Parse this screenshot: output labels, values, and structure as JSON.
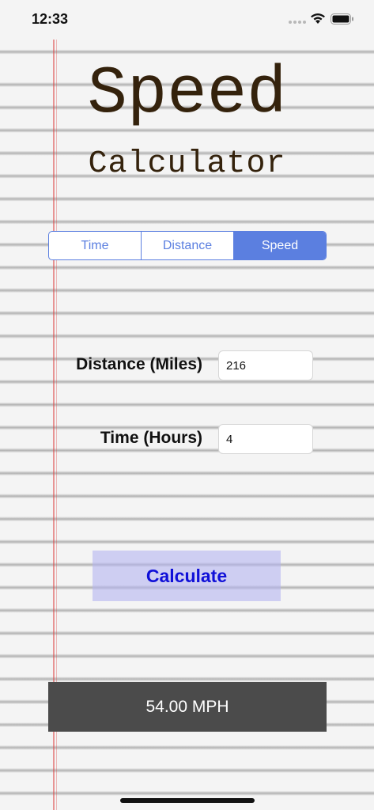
{
  "status_bar": {
    "time": "12:33"
  },
  "header": {
    "title": "Speed",
    "subtitle": "Calculator"
  },
  "mode_selector": {
    "options": [
      "Time",
      "Distance",
      "Speed"
    ],
    "selected": "Speed"
  },
  "form": {
    "distance": {
      "label": "Distance (Miles)",
      "value": "216"
    },
    "time": {
      "label": "Time (Hours)",
      "value": "4"
    }
  },
  "actions": {
    "calculate_label": "Calculate"
  },
  "result": {
    "text": "54.00 MPH"
  },
  "colors": {
    "accent": "#5b7fe0",
    "title": "#34220c",
    "button_text": "#1010d8",
    "result_bg": "#4b4b4b",
    "margin_line": "#dc4646"
  },
  "icons": [
    "signal-icon",
    "wifi-icon",
    "battery-icon"
  ]
}
